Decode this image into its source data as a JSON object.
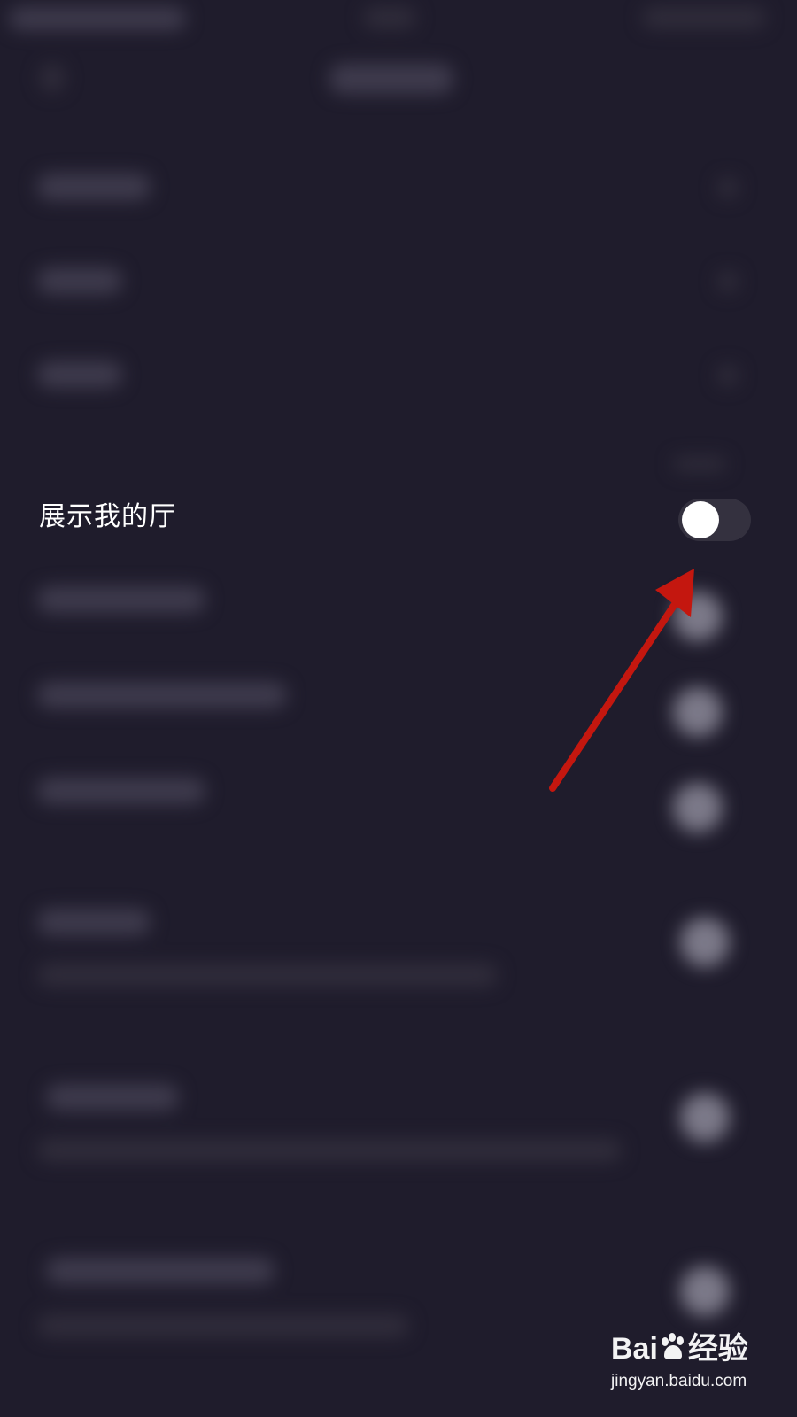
{
  "settings": {
    "show_my_hall": {
      "label": "展示我的厅",
      "enabled": false
    }
  },
  "annotation": {
    "arrow_color": "#c4170f",
    "arrow_icon": "red-arrow-annotation-icon"
  },
  "watermark": {
    "brand_left": "Bai",
    "brand_right": "经验",
    "url": "jingyan.baidu.com"
  }
}
